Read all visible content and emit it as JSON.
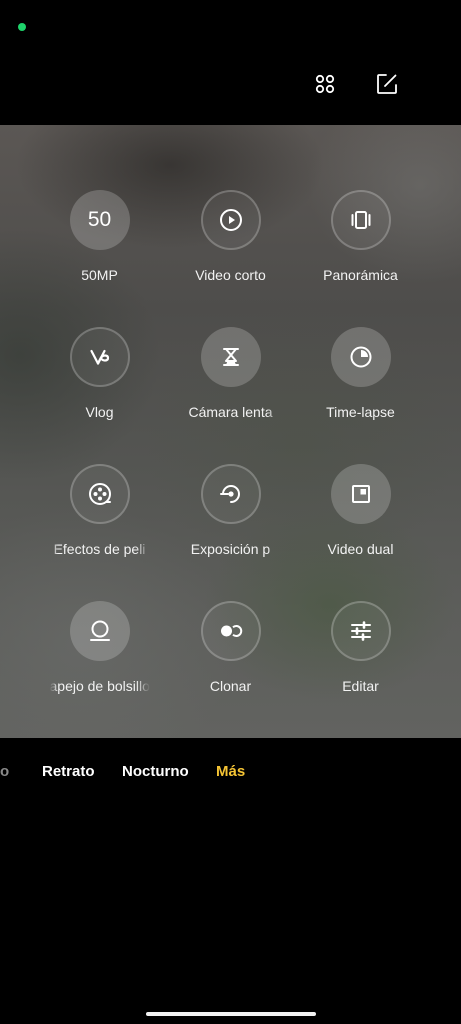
{
  "status": {
    "indicator_color": "#1ed36b"
  },
  "top_bar": {
    "grid_icon": "grid-icon",
    "edit_icon": "edit-icon"
  },
  "modes": [
    {
      "label": "50MP",
      "icon": "50",
      "style": "filled"
    },
    {
      "label": "Video corto",
      "icon": "play-icon",
      "style": "outline"
    },
    {
      "label": "Panorámica",
      "icon": "panorama-icon",
      "style": "outline"
    },
    {
      "label": "Vlog",
      "icon": "vlog-icon",
      "style": "outline"
    },
    {
      "label": "Cámara lenta",
      "icon": "hourglass-icon",
      "style": "filled"
    },
    {
      "label": "Time-lapse",
      "icon": "timelapse-icon",
      "style": "filled"
    },
    {
      "label": "Efectos de peli",
      "icon": "film-reel-icon",
      "style": "outline"
    },
    {
      "label": "Exposición p",
      "icon": "long-exposure-icon",
      "style": "outline"
    },
    {
      "label": "Video dual",
      "icon": "dual-video-icon",
      "style": "filled"
    },
    {
      "label": "apejo de bolsillo",
      "icon": "pocket-mirror-icon",
      "style": "filled"
    },
    {
      "label": "Clonar",
      "icon": "clone-icon",
      "style": "outline"
    },
    {
      "label": "Editar",
      "icon": "sliders-icon",
      "style": "outline"
    }
  ],
  "tabs": {
    "partial": "to",
    "portrait": "Retrato",
    "night": "Nocturno",
    "more": "Más",
    "active_color": "#f5c434"
  }
}
